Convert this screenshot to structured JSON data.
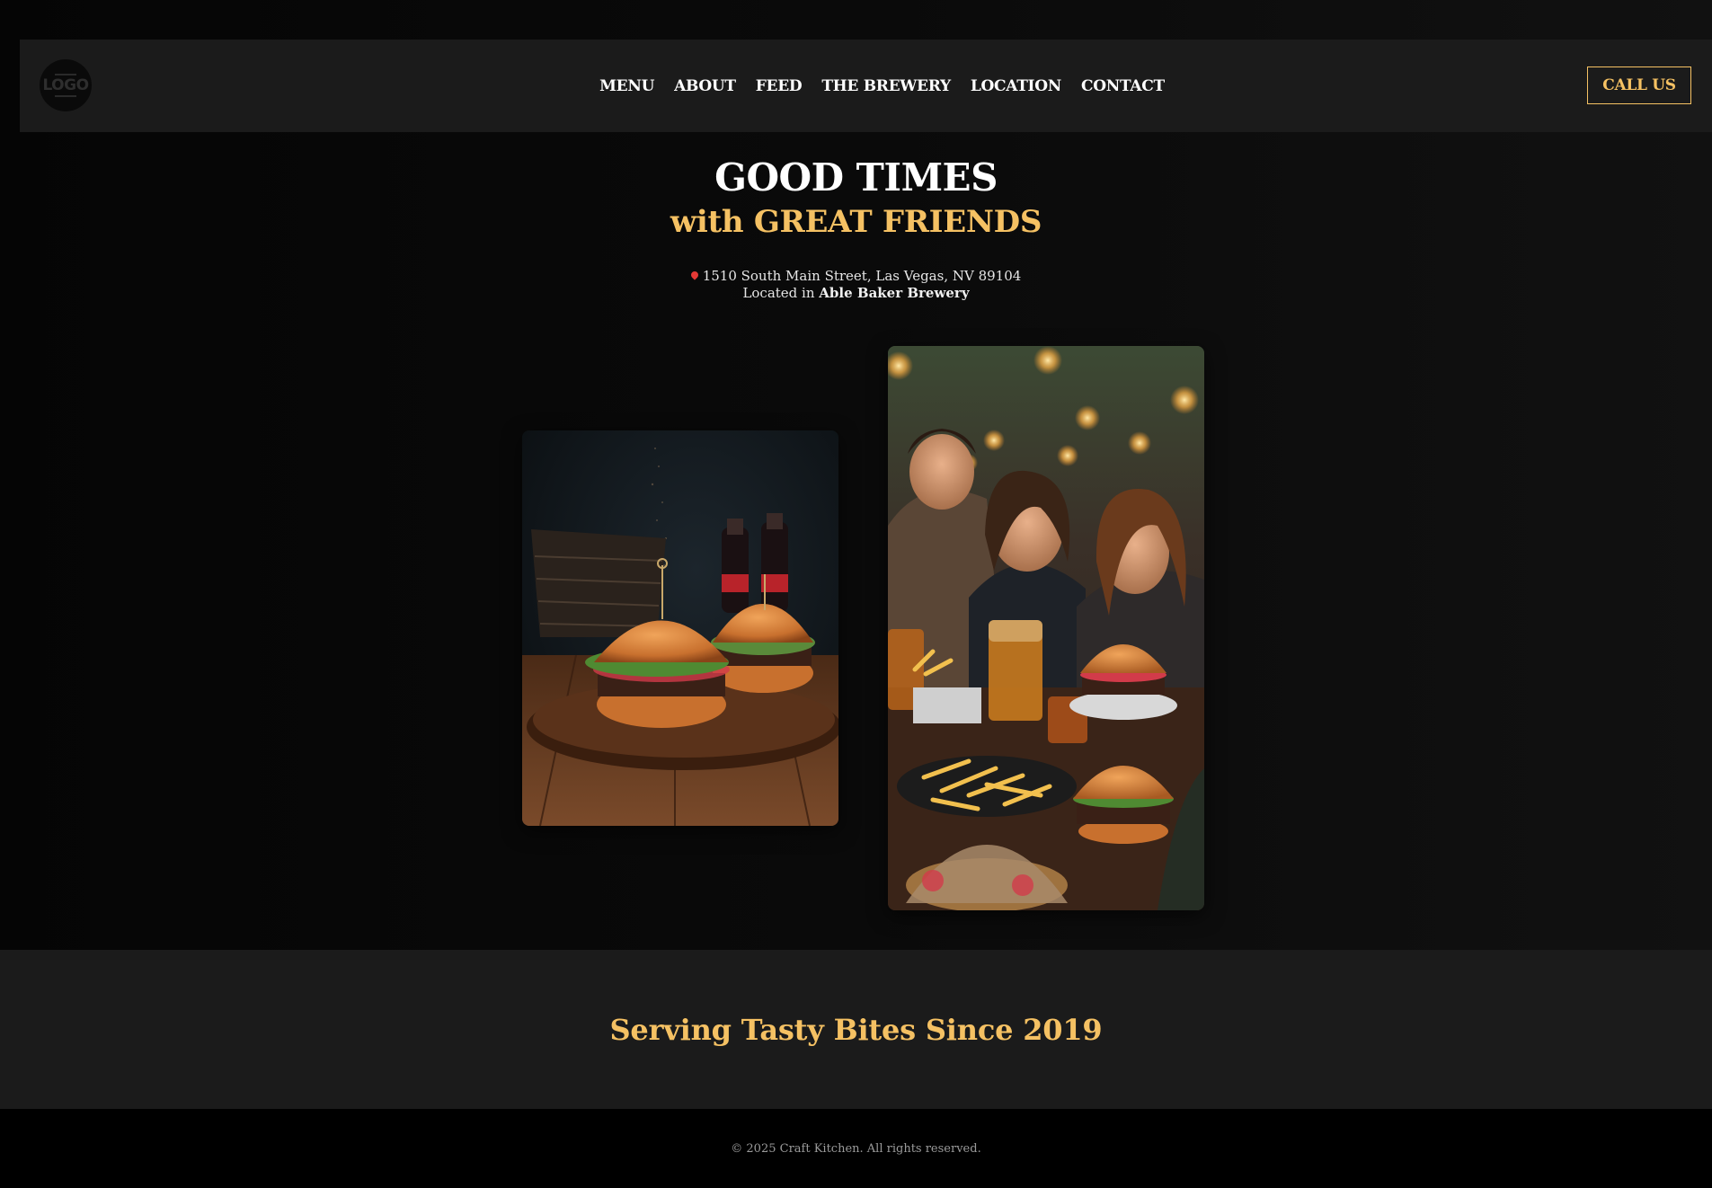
{
  "header": {
    "logo_text": "LOGO",
    "nav": [
      {
        "label": "MENU"
      },
      {
        "label": "ABOUT"
      },
      {
        "label": "FEED"
      },
      {
        "label": "THE BREWERY"
      },
      {
        "label": "LOCATION"
      },
      {
        "label": "CONTACT"
      }
    ],
    "cta_label": "CALL US"
  },
  "hero": {
    "title": "GOOD TIMES",
    "subtitle": "with GREAT FRIENDS",
    "address": "1510 South Main Street, Las Vegas, NV 89104",
    "located_prefix": "Located in",
    "located_venue": "Able Baker Brewery",
    "location_icon": "map-pin-icon"
  },
  "gallery": [
    {
      "name": "burgers-photo",
      "subject": "burgers on a wooden board with bottled drinks"
    },
    {
      "name": "friends-photo",
      "subject": "friends laughing at a table with burgers, fries and drinks"
    }
  ],
  "tagline": "Serving Tasty Bites Since 2019",
  "footer": {
    "copyright": "© 2025 Craft Kitchen. All rights reserved."
  },
  "colors": {
    "accent": "#f5c163",
    "background": "#0b0b0b",
    "header_bg": "#1b1b1b",
    "footer_bg": "#000000"
  }
}
